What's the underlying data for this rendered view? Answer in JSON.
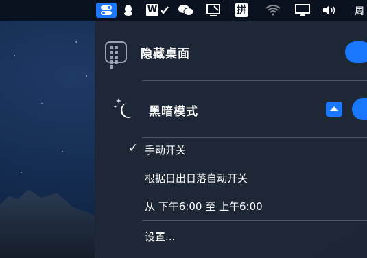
{
  "menubar": {
    "icons": [
      "toggle-switch-icon",
      "qq-penguin-icon",
      "wps-icon",
      "wechat-icon",
      "screen-note-icon",
      "pinyin-input-icon",
      "wifi-icon",
      "airplay-icon",
      "volume-icon"
    ],
    "pinyin_label": "拼",
    "wps_label": "W",
    "clock_text": "周"
  },
  "panel": {
    "hide_desktop_label": "隐藏桌面",
    "dark_mode_label": "黑暗模式",
    "accent_color": "#1a78ff",
    "options": {
      "manual_label": "手动开关",
      "auto_sun_label": "根据日出日落自动开关",
      "schedule_label": "从 下午6:00 至 上午6:00",
      "settings_label": "设置..."
    }
  }
}
